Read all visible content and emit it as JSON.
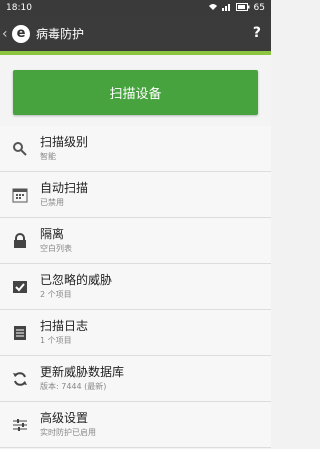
{
  "status": {
    "time": "18:10",
    "battery": "65"
  },
  "appbar": {
    "title": "病毒防护",
    "help": "?"
  },
  "scan": {
    "label": "扫描设备"
  },
  "items": [
    {
      "label": "扫描级别",
      "sub": "智能",
      "icon": "search-icon"
    },
    {
      "label": "自动扫描",
      "sub": "已禁用",
      "icon": "calendar-icon"
    },
    {
      "label": "隔离",
      "sub": "空白列表",
      "icon": "lock-icon"
    },
    {
      "label": "已忽略的威胁",
      "sub": "2 个项目",
      "icon": "check-box-icon"
    },
    {
      "label": "扫描日志",
      "sub": "1 个项目",
      "icon": "log-icon"
    },
    {
      "label": "更新威胁数据库",
      "sub": "版本: 7444 (最新)",
      "icon": "refresh-icon"
    },
    {
      "label": "高级设置",
      "sub": "实时防护已启用",
      "icon": "sliders-icon"
    }
  ]
}
